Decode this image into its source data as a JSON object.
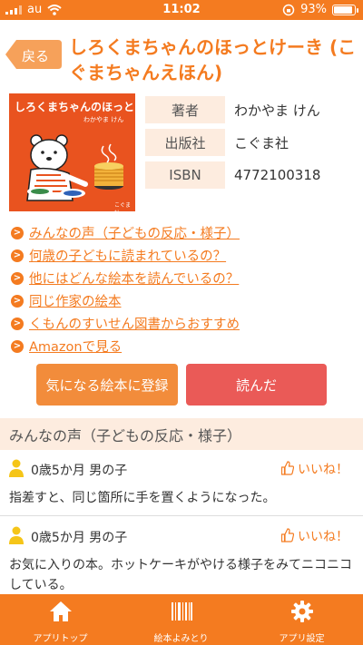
{
  "status_bar": {
    "carrier": "au",
    "time": "11:02",
    "battery": "93%",
    "battery_level": 0.93
  },
  "header": {
    "back_label": "戻る",
    "title": "しろくまちゃんのほっとけーき (こぐまちゃんえほん)"
  },
  "cover": {
    "title_text": "しろくまちゃんのほっとけーき",
    "author_text": "わかやま けん",
    "publisher_text": "こぐま社"
  },
  "book_info": [
    {
      "label": "著者",
      "value": "わかやま けん"
    },
    {
      "label": "出版社",
      "value": "こぐま社"
    },
    {
      "label": "ISBN",
      "value": "4772100318"
    }
  ],
  "links": [
    "みんなの声（子どもの反応・様子）",
    "何歳の子どもに読まれているの？",
    "他にはどんな絵本を読んでいるの？",
    "同じ作家の絵本",
    "くもんのすいせん図書からおすすめ",
    "Amazonで見る"
  ],
  "buttons": {
    "register": "気になる絵本に登録",
    "read": "読んだ"
  },
  "voices": {
    "heading": "みんなの声（子どもの反応・様子）",
    "like_label": "いいね！",
    "reviews": [
      {
        "user": "0歳5か月 男の子",
        "text": "指差すと、同じ箇所に手を置くようになった。"
      },
      {
        "user": "0歳5か月 男の子",
        "text": "お気に入りの本。ホットケーキがやける様子をみてニコニコしている。"
      }
    ]
  },
  "tabbar": [
    {
      "label": "アプリトップ",
      "icon": "home-icon"
    },
    {
      "label": "絵本よみとり",
      "icon": "barcode-icon"
    },
    {
      "label": "アプリ設定",
      "icon": "gear-icon"
    }
  ],
  "colors": {
    "accent": "#f47b20",
    "read_button": "#ea5a57",
    "section_bg": "#fdecdf"
  }
}
